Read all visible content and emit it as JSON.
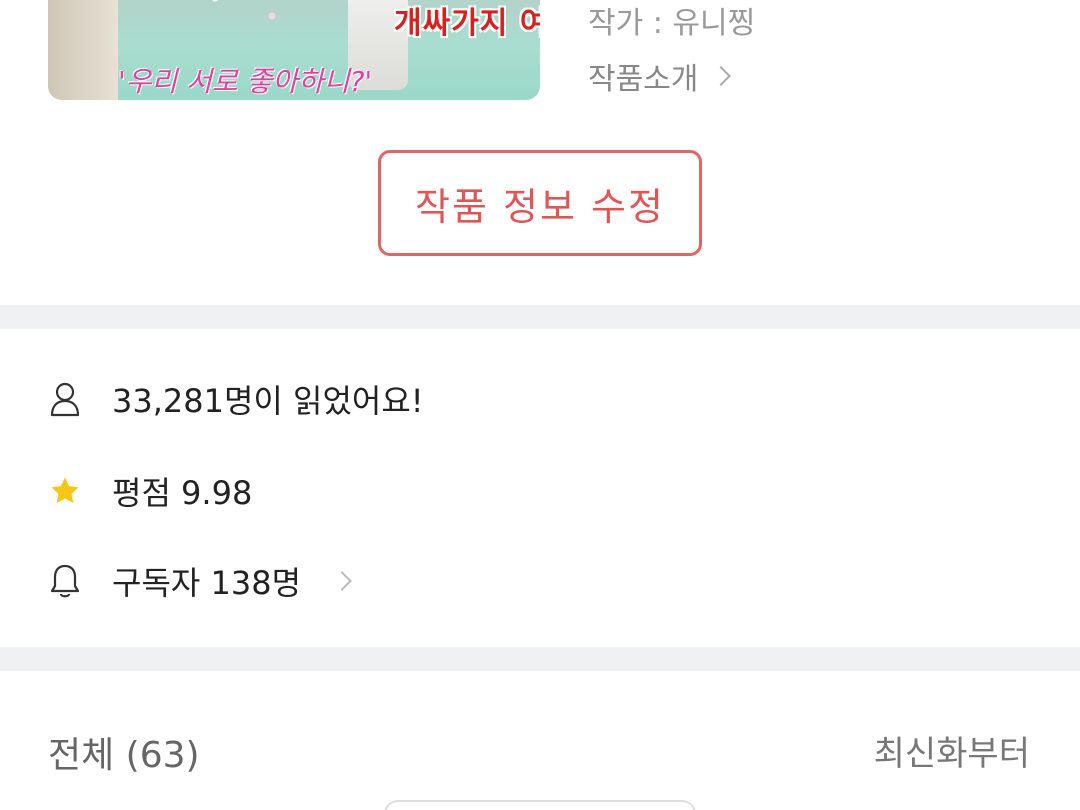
{
  "cover": {
    "banner_text": "개싸가지 여주",
    "tagline_text": "'우리 서로 좋아하니?'"
  },
  "work": {
    "author": "작가 : 유니찡",
    "intro_link": "작품소개",
    "edit_button": "작품 정보 수정"
  },
  "stats": {
    "readers": "33,281명이 읽었어요!",
    "rating": "평점 9.98",
    "subscribers": "구독자 138명"
  },
  "episodes": {
    "header": "전체 (63)",
    "sort_label": "최신화부터"
  },
  "icons": {
    "readers": "person-icon",
    "rating": "star-icon",
    "subscribers": "bell-icon"
  },
  "colors": {
    "accent": "#e05555",
    "star": "#f5c518",
    "divider": "#f0f1f3"
  }
}
